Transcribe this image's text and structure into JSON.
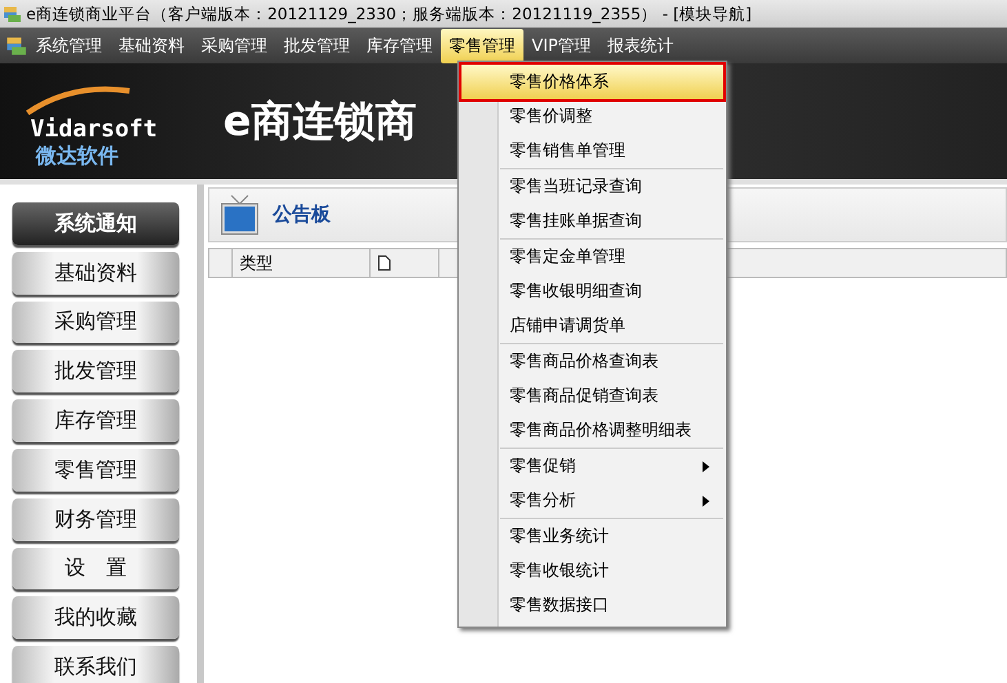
{
  "window": {
    "title": "e商连锁商业平台（客户端版本：20121129_2330；服务端版本：20121119_2355） - [模块导航]"
  },
  "menubar": [
    {
      "label": "系统管理",
      "selected": false
    },
    {
      "label": "基础资料",
      "selected": false
    },
    {
      "label": "采购管理",
      "selected": false
    },
    {
      "label": "批发管理",
      "selected": false
    },
    {
      "label": "库存管理",
      "selected": false
    },
    {
      "label": "零售管理",
      "selected": true
    },
    {
      "label": "VIP管理",
      "selected": false
    },
    {
      "label": "报表统计",
      "selected": false
    }
  ],
  "banner": {
    "logo_text": "Vidarsoft",
    "logo_subtitle": "微达软件",
    "title": "e商连锁商"
  },
  "sidebar": [
    {
      "label": "系统通知",
      "selected": true
    },
    {
      "label": "基础资料",
      "selected": false
    },
    {
      "label": "采购管理",
      "selected": false
    },
    {
      "label": "批发管理",
      "selected": false
    },
    {
      "label": "库存管理",
      "selected": false
    },
    {
      "label": "零售管理",
      "selected": false
    },
    {
      "label": "财务管理",
      "selected": false
    },
    {
      "label": "设　置",
      "selected": false
    },
    {
      "label": "我的收藏",
      "selected": false
    },
    {
      "label": "联系我们",
      "selected": false
    }
  ],
  "panel": {
    "title": "公告板",
    "columns": [
      {
        "kind": "text",
        "label": "类型"
      },
      {
        "kind": "file-icon"
      }
    ]
  },
  "dropdown": [
    [
      {
        "label": "零售价格体系",
        "selected": true,
        "submenu": false
      },
      {
        "label": "零售价调整",
        "selected": false,
        "submenu": false
      },
      {
        "label": "零售销售单管理",
        "selected": false,
        "submenu": false
      }
    ],
    [
      {
        "label": "零售当班记录查询",
        "selected": false,
        "submenu": false
      },
      {
        "label": "零售挂账单据查询",
        "selected": false,
        "submenu": false
      }
    ],
    [
      {
        "label": "零售定金单管理",
        "selected": false,
        "submenu": false
      },
      {
        "label": "零售收银明细查询",
        "selected": false,
        "submenu": false
      },
      {
        "label": "店铺申请调货单",
        "selected": false,
        "submenu": false
      }
    ],
    [
      {
        "label": "零售商品价格查询表",
        "selected": false,
        "submenu": false
      },
      {
        "label": "零售商品促销查询表",
        "selected": false,
        "submenu": false
      },
      {
        "label": "零售商品价格调整明细表",
        "selected": false,
        "submenu": false
      }
    ],
    [
      {
        "label": "零售促销",
        "selected": false,
        "submenu": true
      },
      {
        "label": "零售分析",
        "selected": false,
        "submenu": true
      }
    ],
    [
      {
        "label": "零售业务统计",
        "selected": false,
        "submenu": false
      },
      {
        "label": "零售收银统计",
        "selected": false,
        "submenu": false
      },
      {
        "label": "零售数据接口",
        "selected": false,
        "submenu": false
      }
    ]
  ]
}
